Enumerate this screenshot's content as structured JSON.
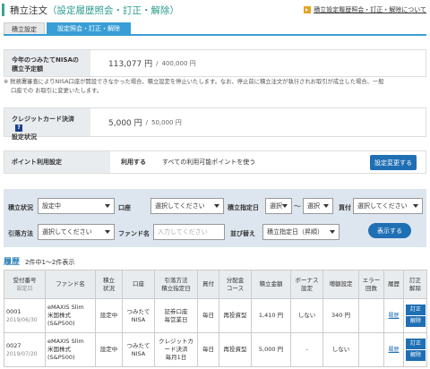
{
  "header": {
    "title": "積立注文",
    "subtitle": "（設定履歴照会・訂正・解除）",
    "link_label": "積立設定履歴照会・訂正・解除について"
  },
  "tabs": [
    {
      "label": "積立設定",
      "active": false
    },
    {
      "label": "設定照会・訂正・解除",
      "active": true
    }
  ],
  "nisa": {
    "label_line1": "今年のつみたてNISAの",
    "label_line2": "積立予定額",
    "amount": "113,077 円",
    "separator": "/",
    "limit": "400,000 円"
  },
  "note": {
    "line1": "※ 税務署審査によりNISA口座が開設できなかった場合、積立設定を停止いたします。なお、停止前に積立注文が執行されお取引が成立した場合、一般",
    "line2": "口座での お取引に変更いたします。"
  },
  "credit": {
    "label_line1": "クレジットカード決済",
    "label_line2": "設定状況",
    "help": "?",
    "amount": "5,000 円",
    "separator": "/",
    "limit": "50,000 円"
  },
  "points": {
    "label": "ポイント利用設定",
    "value": "利用する",
    "desc": "すべての利用可能ポイントを使う",
    "button": "設定変更する"
  },
  "search": {
    "status_label": "積立状況",
    "status_value": "設定中",
    "account_label": "口座",
    "account_value": "選択してください",
    "date_label": "積立指定日",
    "date_from": "選択",
    "tilde": "〜",
    "date_to": "選択",
    "buysell_label": "買付",
    "buysell_value": "選択してください",
    "method_label": "引落方法",
    "method_value": "選択してください",
    "fund_label": "ファンド名",
    "fund_placeholder": "入力してください",
    "sort_label": "並び替え",
    "sort_value": "積立指定日（昇順）",
    "show_button": "表示する"
  },
  "history": {
    "title": "履歴",
    "count": "2件中1〜2件表示"
  },
  "table": {
    "headers": [
      [
        "受付番号",
        "設定日"
      ],
      [
        "ファンド名"
      ],
      [
        "積立",
        "状況"
      ],
      [
        "口座"
      ],
      [
        "引落方法",
        "積立指定日"
      ],
      [
        "買付"
      ],
      [
        "分配金",
        "コース"
      ],
      [
        "積立金額"
      ],
      [
        "ボーナス",
        "設定"
      ],
      [
        "増額設定"
      ],
      [
        "エラー",
        "回数"
      ],
      [
        "履歴"
      ],
      [
        "訂正",
        "解除"
      ]
    ],
    "rows": [
      {
        "id": "0001",
        "date": "2019/06/30",
        "fund": [
          "eMAXIS Slim",
          "米国株式",
          "(S&P500)"
        ],
        "status": "設定中",
        "account": [
          "つみたて",
          "NISA"
        ],
        "method": [
          "証券口座",
          "毎営業日"
        ],
        "buy": "毎日",
        "dist": "再投資型",
        "amount": "1,410 円",
        "bonus": "しない",
        "increase": "340 円",
        "errors": "",
        "history_link": "履歴",
        "btn_edit": "訂正",
        "btn_cancel": "解除"
      },
      {
        "id": "0027",
        "date": "2019/07/20",
        "fund": [
          "eMAXIS Slim",
          "米国株式",
          "(S&P500)"
        ],
        "status": "設定中",
        "account": [
          "つみたて",
          "NISA"
        ],
        "method": [
          "クレジットカ",
          "ード決済",
          "毎月1日"
        ],
        "buy": "毎日",
        "dist": "再投資型",
        "amount": "5,000 円",
        "bonus": "-",
        "increase": "しない",
        "errors": "",
        "history_link": "履歴",
        "btn_edit": "訂正",
        "btn_cancel": "解除"
      }
    ]
  },
  "colors": {
    "accent": "#3a9ed6",
    "button": "#1f6fb4",
    "title_accent": "#2a9a8e",
    "search_bg": "#dde6ef"
  }
}
